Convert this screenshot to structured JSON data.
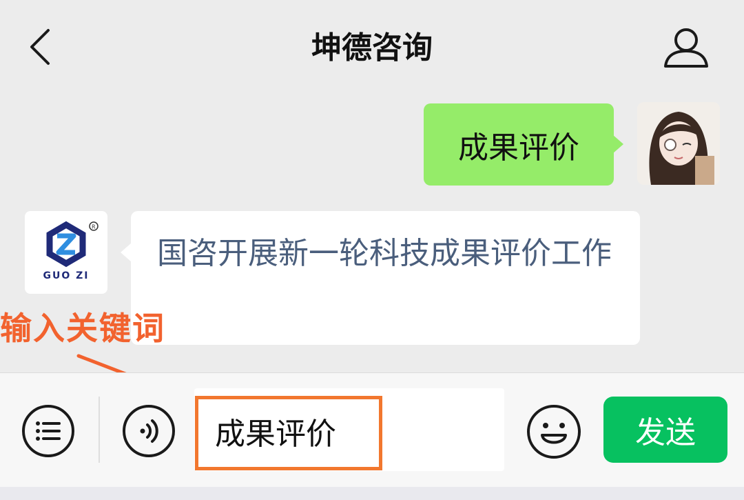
{
  "header": {
    "title": "坤德咨询",
    "back_icon": "chevron-left-icon",
    "profile_icon": "person-icon"
  },
  "messages": {
    "outgoing": {
      "text": "成果评价"
    },
    "incoming": {
      "text": "国咨开展新一轮科技成果评价工作",
      "sender_logo_text": "GUO ZI"
    }
  },
  "annotation": {
    "text": "输入关键词",
    "color": "#f2622e"
  },
  "input_bar": {
    "value": "成果评价",
    "send_label": "发送",
    "menu_icon": "list-menu-icon",
    "voice_icon": "voice-icon",
    "emoji_icon": "emoji-icon"
  },
  "colors": {
    "outgoing_bubble": "#95ec69",
    "send_button": "#07c160",
    "link_text": "#4a5e7c"
  }
}
